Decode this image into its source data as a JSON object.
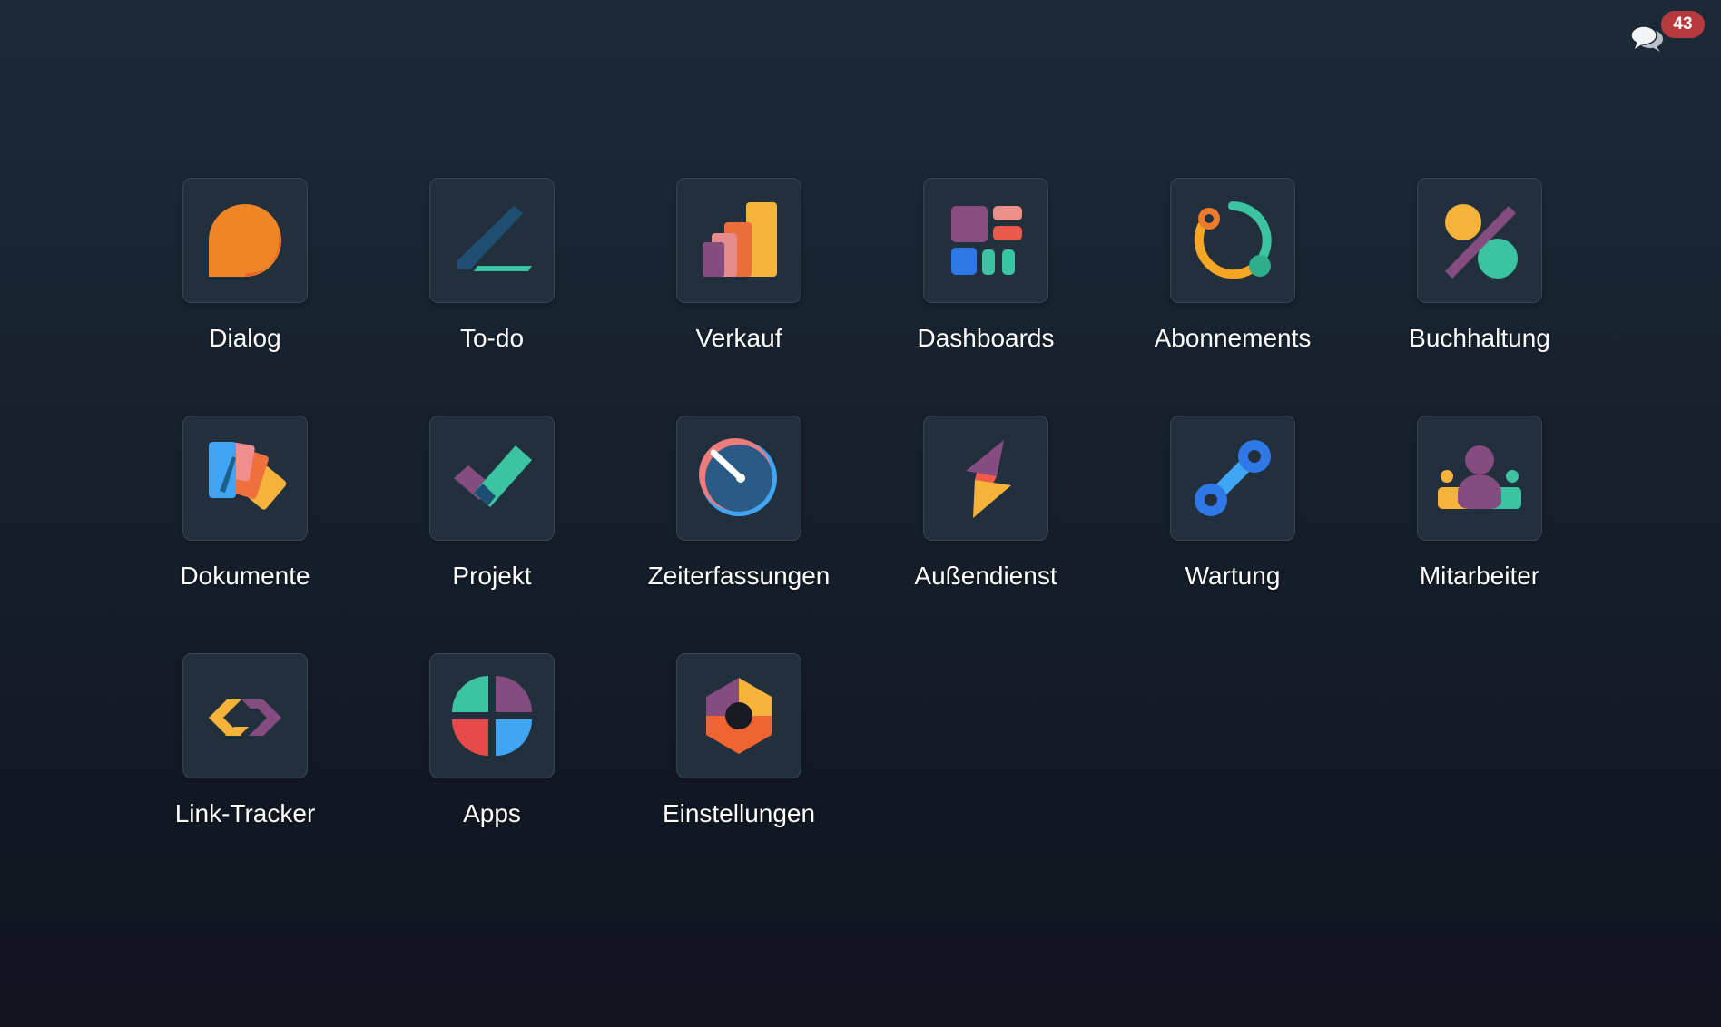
{
  "topbar": {
    "messages_count": "43",
    "messages_icon": "chat-bubbles-icon"
  },
  "apps": [
    {
      "label": "Dialog",
      "icon": "dialog-icon"
    },
    {
      "label": "To-do",
      "icon": "todo-icon"
    },
    {
      "label": "Verkauf",
      "icon": "sales-icon"
    },
    {
      "label": "Dashboards",
      "icon": "dashboards-icon"
    },
    {
      "label": "Abonnements",
      "icon": "subscriptions-icon"
    },
    {
      "label": "Buchhaltung",
      "icon": "accounting-icon"
    },
    {
      "label": "Dokumente",
      "icon": "documents-icon"
    },
    {
      "label": "Projekt",
      "icon": "project-icon"
    },
    {
      "label": "Zeiterfassungen",
      "icon": "timesheets-icon"
    },
    {
      "label": "Außendienst",
      "icon": "field-service-icon"
    },
    {
      "label": "Wartung",
      "icon": "maintenance-icon"
    },
    {
      "label": "Mitarbeiter",
      "icon": "employees-icon"
    },
    {
      "label": "Link-Tracker",
      "icon": "link-tracker-icon"
    },
    {
      "label": "Apps",
      "icon": "apps-icon"
    },
    {
      "label": "Einstellungen",
      "icon": "settings-icon"
    }
  ],
  "colors": {
    "background": "#1a2431",
    "tile_background": "#22303e",
    "badge": "#b6393d",
    "label": "#ffffff"
  }
}
